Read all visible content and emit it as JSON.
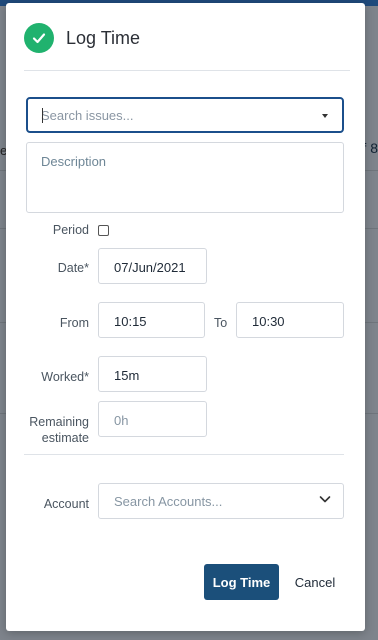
{
  "dialog": {
    "title": "Log Time",
    "icon": "check-circle-icon",
    "accent_color": "#20b26e"
  },
  "search_issues": {
    "placeholder": "Search issues..."
  },
  "description": {
    "placeholder": "Description"
  },
  "period": {
    "label": "Period",
    "checked": false
  },
  "date": {
    "label": "Date*",
    "value": "07/Jun/2021"
  },
  "from": {
    "label": "From",
    "value": "10:15"
  },
  "to": {
    "label": "To",
    "value": "10:30"
  },
  "worked": {
    "label": "Worked*",
    "value": "15m"
  },
  "remaining": {
    "label_line1": "Remaining",
    "label_line2": "estimate",
    "placeholder": "0h"
  },
  "account": {
    "label": "Account",
    "placeholder": "Search Accounts..."
  },
  "actions": {
    "submit": "Log Time",
    "cancel": "Cancel",
    "primary_color": "#1b4f7a"
  },
  "background": {
    "left_edge_text": "e",
    "right_edge_text": "f 8"
  }
}
